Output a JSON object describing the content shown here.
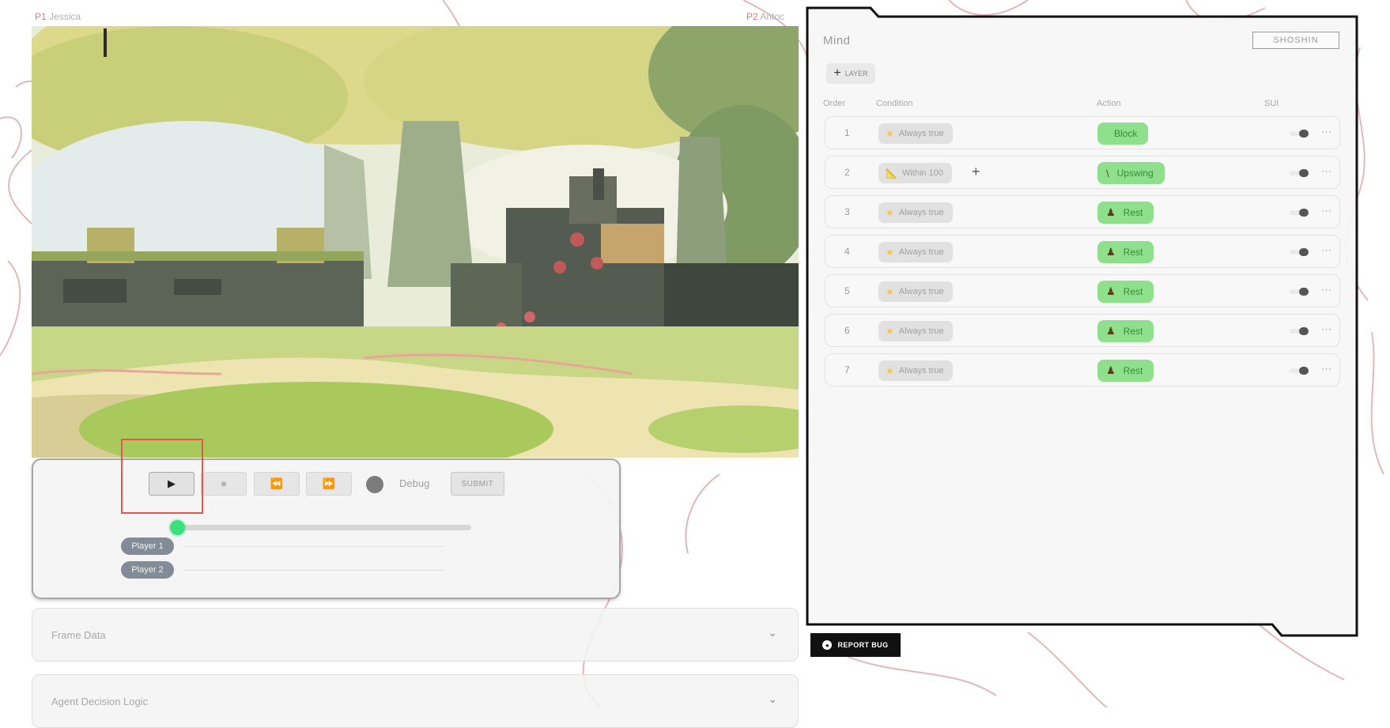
{
  "players": {
    "p1": {
      "tag": "P1",
      "name": "Jessica"
    },
    "p2": {
      "tag": "P2",
      "name": "Antoc"
    }
  },
  "controls": {
    "play_icon": "play-icon",
    "stop_icon": "stop-icon",
    "rewind_icon": "step-back-icon",
    "forward_icon": "step-forward-icon",
    "play_symbol": "▶",
    "stop_symbol": "⏹",
    "rewind_symbol": "⏪",
    "forward_symbol": "⏩",
    "debug_label": "Debug",
    "submit_label": "SUBMIT",
    "timeline_progress": 0,
    "player1_label": "Player 1",
    "player2_label": "Player 2"
  },
  "accordions": {
    "frame_data": "Frame Data",
    "agent_logic": "Agent Decision Logic",
    "chevron": "⌄"
  },
  "mind": {
    "title": "Mind",
    "mode_button": "SHOSHIN",
    "add_layer_label": "LAYER",
    "add_layer_symbol": "+",
    "columns": {
      "order": "Order",
      "condition": "Condition",
      "action": "Action",
      "sui": "SUI"
    },
    "rules": [
      {
        "order": "1",
        "condition": "Always true",
        "condition_icon": "star-icon",
        "action": "Block",
        "action_icon": "none",
        "has_plus": false
      },
      {
        "order": "2",
        "condition": "Within 100",
        "condition_icon": "ruler-icon",
        "action": "Upswing",
        "action_icon": "sword-icon",
        "has_plus": true
      },
      {
        "order": "3",
        "condition": "Always true",
        "condition_icon": "star-icon",
        "action": "Rest",
        "action_icon": "bag-icon",
        "has_plus": false
      },
      {
        "order": "4",
        "condition": "Always true",
        "condition_icon": "star-icon",
        "action": "Rest",
        "action_icon": "bag-icon",
        "has_plus": false
      },
      {
        "order": "5",
        "condition": "Always true",
        "condition_icon": "star-icon",
        "action": "Rest",
        "action_icon": "bag-icon",
        "has_plus": false
      },
      {
        "order": "6",
        "condition": "Always true",
        "condition_icon": "star-icon",
        "action": "Rest",
        "action_icon": "bag-icon",
        "has_plus": false
      },
      {
        "order": "7",
        "condition": "Always true",
        "condition_icon": "star-icon",
        "action": "Rest",
        "action_icon": "bag-icon",
        "has_plus": false
      }
    ]
  },
  "report_bug": "REPORT BUG",
  "colors": {
    "accent_green": "#8ee08c",
    "timeline_thumb": "#3be07d",
    "highlight": "#e4574b",
    "sketch": "#d9a0a4"
  }
}
